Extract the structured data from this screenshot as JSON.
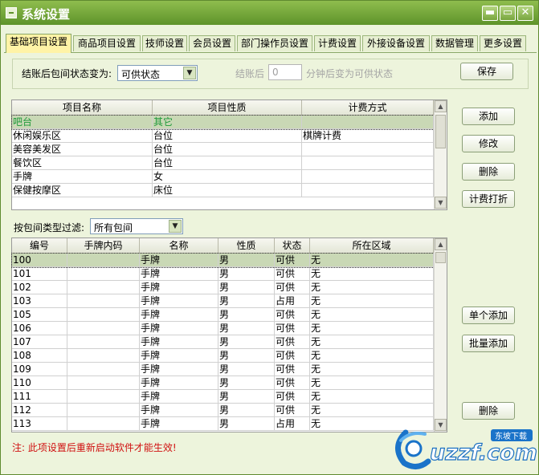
{
  "window": {
    "title": "系统设置",
    "btn_minimize": "▬",
    "btn_restore": "▭",
    "btn_close": "✕"
  },
  "tabs": [
    "基础项目设置",
    "商品项目设置",
    "技师设置",
    "会员设置",
    "部门操作员设置",
    "计费设置",
    "外接设备设置",
    "数据管理",
    "更多设置"
  ],
  "settings": {
    "checkout_label": "结账后包间状态变为:",
    "checkout_value": "可供状态",
    "after_label": "结账后",
    "after_minutes": "0",
    "after_suffix": "分钟后变为可供状态",
    "save": "保存"
  },
  "top_table": {
    "columns": [
      "项目名称",
      "项目性质",
      "计费方式"
    ],
    "rows": [
      [
        "吧台",
        "其它",
        ""
      ],
      [
        "休闲娱乐区",
        "台位",
        "棋牌计费"
      ],
      [
        "美容美发区",
        "台位",
        ""
      ],
      [
        "餐饮区",
        "台位",
        ""
      ],
      [
        "手牌",
        "女",
        ""
      ],
      [
        "保健按摩区",
        "床位",
        ""
      ]
    ]
  },
  "top_buttons": [
    "添加",
    "修改",
    "删除",
    "计费打折"
  ],
  "filter": {
    "label": "按包间类型过滤:",
    "value": "所有包间"
  },
  "bottom_table": {
    "columns": [
      "编号",
      "手牌内码",
      "名称",
      "性质",
      "状态",
      "所在区域"
    ],
    "rows": [
      [
        "100",
        "",
        "手牌",
        "男",
        "可供",
        "无"
      ],
      [
        "101",
        "",
        "手牌",
        "男",
        "可供",
        "无"
      ],
      [
        "102",
        "",
        "手牌",
        "男",
        "可供",
        "无"
      ],
      [
        "103",
        "",
        "手牌",
        "男",
        "占用",
        "无"
      ],
      [
        "105",
        "",
        "手牌",
        "男",
        "可供",
        "无"
      ],
      [
        "106",
        "",
        "手牌",
        "男",
        "可供",
        "无"
      ],
      [
        "107",
        "",
        "手牌",
        "男",
        "可供",
        "无"
      ],
      [
        "108",
        "",
        "手牌",
        "男",
        "可供",
        "无"
      ],
      [
        "109",
        "",
        "手牌",
        "男",
        "可供",
        "无"
      ],
      [
        "110",
        "",
        "手牌",
        "男",
        "可供",
        "无"
      ],
      [
        "111",
        "",
        "手牌",
        "男",
        "可供",
        "无"
      ],
      [
        "112",
        "",
        "手牌",
        "男",
        "可供",
        "无"
      ],
      [
        "113",
        "",
        "手牌",
        "男",
        "占用",
        "无"
      ]
    ]
  },
  "bottom_buttons": [
    "单个添加",
    "批量添加",
    "删除"
  ],
  "note": "注: 此项设置后重新启动软件才能生效!",
  "watermark": {
    "text": "uzzf.com",
    "sub": "东坡下载"
  },
  "colors": {
    "titlebar": "#6fa536",
    "active_tab": "#fff3a6",
    "selected_row": "#c9d8b5",
    "selected_text": "#1f9a3a",
    "note": "#d01010"
  }
}
